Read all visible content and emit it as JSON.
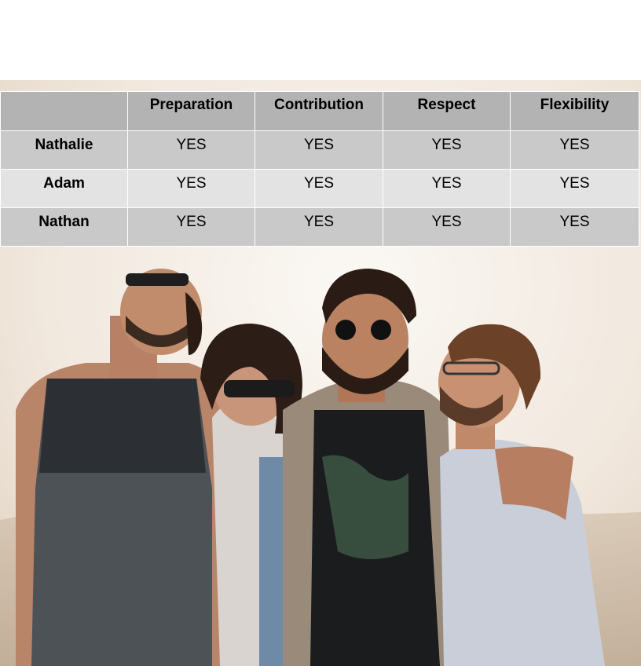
{
  "table": {
    "corner": "",
    "headers": [
      "Preparation",
      "Contribution",
      "Respect",
      "Flexibility"
    ],
    "rows": [
      {
        "name": "Nathalie",
        "cells": [
          "YES",
          "YES",
          "YES",
          "YES"
        ]
      },
      {
        "name": "Adam",
        "cells": [
          "YES",
          "YES",
          "YES",
          "YES"
        ]
      },
      {
        "name": "Nathan",
        "cells": [
          "YES",
          "YES",
          "YES",
          "YES"
        ]
      }
    ]
  },
  "photo": {
    "subject": "four-friends-laughing-photo"
  }
}
